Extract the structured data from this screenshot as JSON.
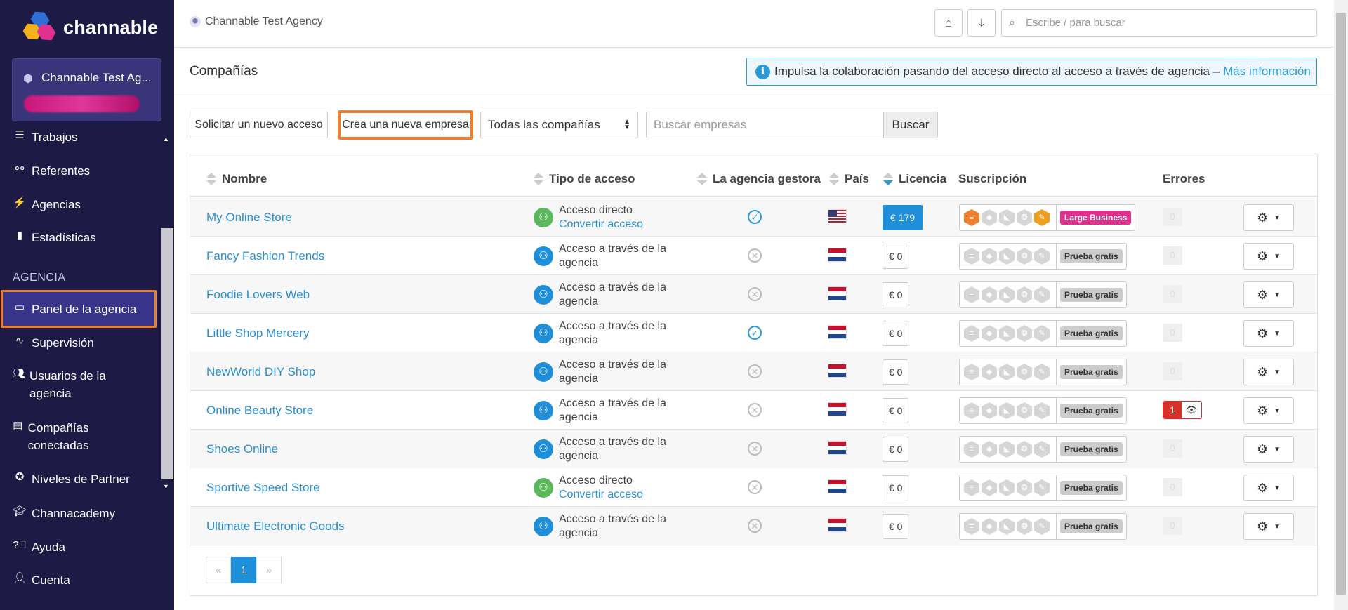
{
  "app": {
    "name": "channable"
  },
  "account": {
    "name": "Channable Test Ag..."
  },
  "nav": [
    {
      "label": "Trabajos",
      "icon": "list-icon"
    },
    {
      "label": "Referentes",
      "icon": "sitemap-icon"
    },
    {
      "label": "Agencias",
      "icon": "bolt-icon"
    },
    {
      "label": "Estadísticas",
      "icon": "chart-icon"
    }
  ],
  "nav_section": "AGENCIA",
  "nav_agency": [
    {
      "label": "Panel de la agencia",
      "icon": "monitor-icon"
    },
    {
      "label": "Supervisión",
      "icon": "pulse-icon"
    },
    {
      "label": "Usuarios de la agencia",
      "icon": "users-icon"
    },
    {
      "label": "Compañías conectadas",
      "icon": "briefcase-icon"
    },
    {
      "label": "Niveles de Partner",
      "icon": "award-icon"
    }
  ],
  "nav_bottom": [
    {
      "label": "Channacademy",
      "icon": "graduation-icon"
    },
    {
      "label": "Ayuda",
      "icon": "help-icon"
    },
    {
      "label": "Cuenta",
      "icon": "user-icon"
    }
  ],
  "topbar": {
    "breadcrumb": "Channable Test Agency",
    "search_placeholder": "Escribe / para buscar"
  },
  "page": {
    "title": "Compañías",
    "info_text": "Impulsa la colaboración pasando del acceso directo al acceso a través de agencia –",
    "info_link": "Más información"
  },
  "controls": {
    "request_access": "Solicitar un nuevo acceso",
    "new_company": "Crea una nueva empresa",
    "filter_selected": "Todas las compañías",
    "search_placeholder": "Buscar empresas",
    "search_button": "Buscar"
  },
  "table": {
    "headers": {
      "name": "Nombre",
      "access": "Tipo de acceso",
      "manager": "La agencia gestora",
      "country": "País",
      "license": "Licencia",
      "subscription": "Suscripción",
      "errors": "Errores"
    },
    "rows": [
      {
        "name": "My Online Store",
        "access": "Acceso directo",
        "access_link": "Convertir acceso",
        "access_type": "direct",
        "managed": true,
        "country": "US",
        "license": "€ 179",
        "license_paid": true,
        "plan": "Large Business",
        "errors": "0",
        "error_active": false
      },
      {
        "name": "Fancy Fashion Trends",
        "access": "Acceso a través de la agencia",
        "access_link": "",
        "access_type": "agency",
        "managed": false,
        "country": "NL",
        "license": "€ 0",
        "license_paid": false,
        "plan": "Prueba gratis",
        "errors": "0",
        "error_active": false
      },
      {
        "name": "Foodie Lovers Web",
        "access": "Acceso a través de la agencia",
        "access_link": "",
        "access_type": "agency",
        "managed": false,
        "country": "NL",
        "license": "€ 0",
        "license_paid": false,
        "plan": "Prueba gratis",
        "errors": "0",
        "error_active": false
      },
      {
        "name": "Little Shop Mercery",
        "access": "Acceso a través de la agencia",
        "access_link": "",
        "access_type": "agency",
        "managed": true,
        "country": "NL",
        "license": "€ 0",
        "license_paid": false,
        "plan": "Prueba gratis",
        "errors": "0",
        "error_active": false
      },
      {
        "name": "NewWorld DIY Shop",
        "access": "Acceso a través de la agencia",
        "access_link": "",
        "access_type": "agency",
        "managed": false,
        "country": "NL",
        "license": "€ 0",
        "license_paid": false,
        "plan": "Prueba gratis",
        "errors": "0",
        "error_active": false
      },
      {
        "name": "Online Beauty Store",
        "access": "Acceso a través de la agencia",
        "access_link": "",
        "access_type": "agency",
        "managed": false,
        "country": "NL",
        "license": "€ 0",
        "license_paid": false,
        "plan": "Prueba gratis",
        "errors": "1",
        "error_active": true
      },
      {
        "name": "Shoes Online",
        "access": "Acceso a través de la agencia",
        "access_link": "",
        "access_type": "agency",
        "managed": false,
        "country": "NL",
        "license": "€ 0",
        "license_paid": false,
        "plan": "Prueba gratis",
        "errors": "0",
        "error_active": false
      },
      {
        "name": "Sportive Speed Store",
        "access": "Acceso directo",
        "access_link": "Convertir acceso",
        "access_type": "direct",
        "managed": false,
        "country": "NL",
        "license": "€ 0",
        "license_paid": false,
        "plan": "Prueba gratis",
        "errors": "0",
        "error_active": false
      },
      {
        "name": "Ultimate Electronic Goods",
        "access": "Acceso a través de la agencia",
        "access_link": "",
        "access_type": "agency",
        "managed": false,
        "country": "NL",
        "license": "€ 0",
        "license_paid": false,
        "plan": "Prueba gratis",
        "errors": "0",
        "error_active": false
      }
    ]
  },
  "pagination": {
    "prev": "«",
    "current": "1",
    "next": "»"
  },
  "colors": {
    "sidebar": "#1d1a45",
    "accent": "#1e8fd8",
    "highlight": "#f07f2d",
    "plan_large": "#e0318f",
    "error": "#d9302c"
  }
}
